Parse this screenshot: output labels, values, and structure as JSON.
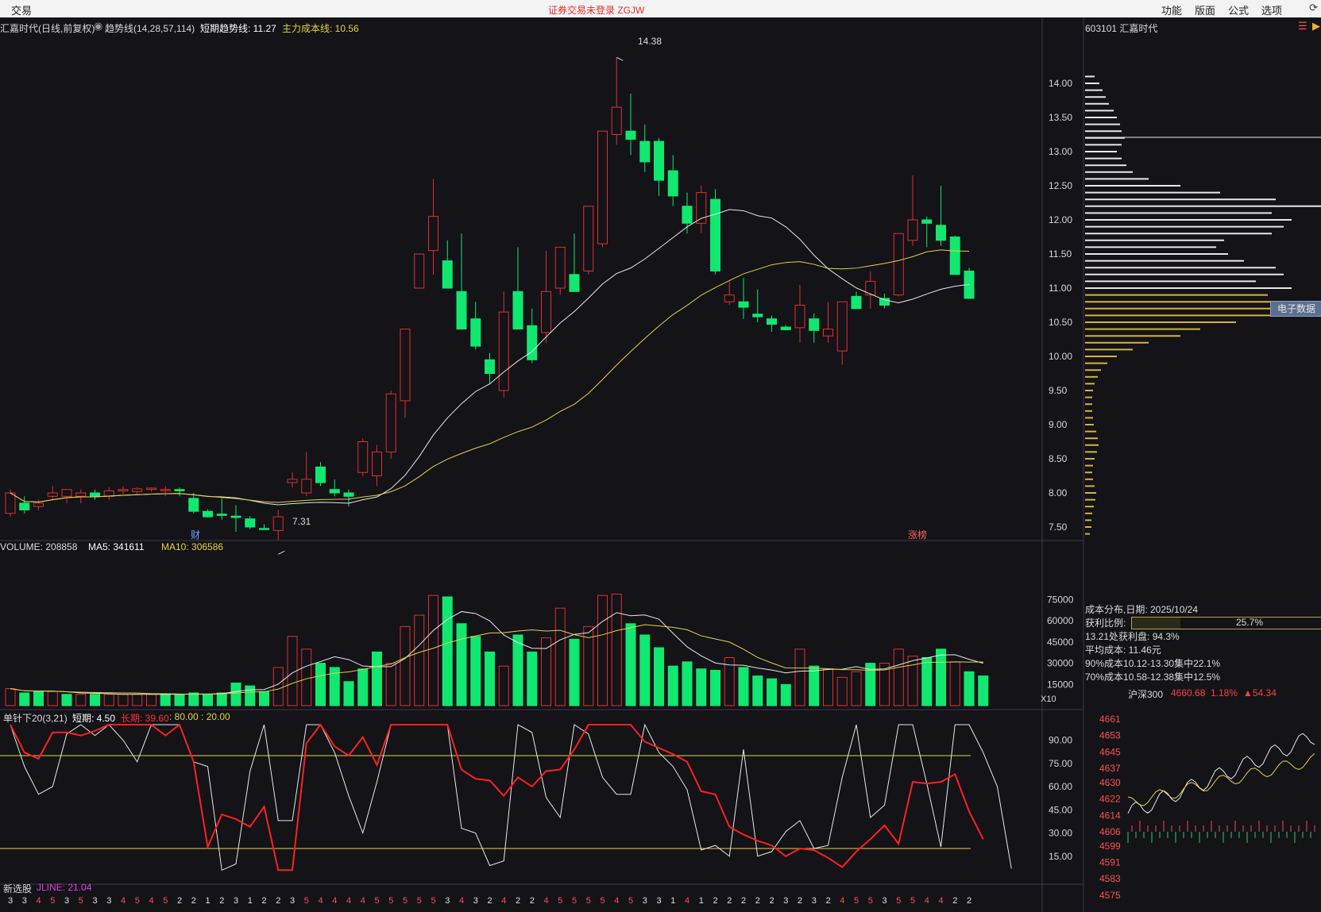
{
  "app": {
    "menu_left": "交易",
    "banner": "证券交易未登录  ZGJW",
    "menu_right": [
      "功能",
      "版面",
      "公式",
      "选项"
    ]
  },
  "main": {
    "title": "汇嘉时代(日线,前复权)",
    "ind_name": "趋势线(14,28,57,114)",
    "ind_short": "短期趋势线: 11.27",
    "ind_cost": "主力成本线: 10.56",
    "high_label": "14.38",
    "low_label": "7.31",
    "marker_cai": "财",
    "marker_zb": "涨榜",
    "y_ticks": [
      "14.00",
      "13.50",
      "13.00",
      "12.50",
      "12.00",
      "11.50",
      "11.00",
      "10.50",
      "10.00",
      "9.50",
      "9.00",
      "8.50",
      "8.00",
      "7.50"
    ]
  },
  "volume": {
    "label": "VOLUME: 208858",
    "ma5": "MA5: 341611",
    "ma10": "MA10: 306586",
    "y_ticks": [
      "75000",
      "60000",
      "45000",
      "30000",
      "15000"
    ],
    "unit": "X10"
  },
  "oscillator": {
    "name": "单针下20(3,21)",
    "short": "短期: 4.50",
    "long": "长期: 39.60",
    "levels": ": 80.00 : 20.00",
    "y_ticks": [
      "90.00",
      "75.00",
      "60.00",
      "45.00",
      "30.00",
      "15.00"
    ]
  },
  "bottom": {
    "label": "新选股",
    "jline": "JLINE: 21.04",
    "digits": [
      "3",
      "3",
      "4",
      "5",
      "3",
      "5",
      "3",
      "3",
      "4",
      "5",
      "4",
      "5",
      "2",
      "2",
      "1",
      "2",
      "3",
      "1",
      "2",
      "2",
      "3",
      "5",
      "4",
      "4",
      "4",
      "4",
      "5",
      "5",
      "5",
      "5",
      "5",
      "3",
      "4",
      "3",
      "2",
      "4",
      "2",
      "2",
      "4",
      "5",
      "5",
      "5",
      "5",
      "4",
      "5",
      "3",
      "3",
      "1",
      "4",
      "1",
      "2",
      "2",
      "2",
      "2",
      "2",
      "3",
      "2",
      "3",
      "2",
      "4",
      "5",
      "5",
      "3",
      "5",
      "5",
      "4",
      "4",
      "2",
      "2"
    ]
  },
  "right_panel": {
    "code": "603101 汇嘉时代",
    "tag": "电子数据",
    "dist_date": "成本分布,日期: 2025/10/24",
    "profit_label": "获利比例:",
    "profit_pct": "25.7%",
    "profit_value": 0.257,
    "profit_line": "13.21处获利盘: 94.3%",
    "avg_cost": "平均成本: 11.46元",
    "c90": "90%成本10.12-13.30集中22.1%",
    "c70": "70%成本10.58-12.38集中12.5%"
  },
  "index_chart": {
    "name": "沪深300",
    "price": "4660.68",
    "pct": "1.18%",
    "chg": "▲54.34",
    "y_ticks": [
      "4661",
      "4653",
      "4645",
      "4637",
      "4630",
      "4622",
      "4614",
      "4606",
      "4599",
      "4591",
      "4583",
      "4575"
    ]
  },
  "candles": [
    {
      "o": 7.7,
      "h": 8.05,
      "l": 7.65,
      "c": 8.0
    },
    {
      "o": 7.85,
      "h": 7.95,
      "l": 7.7,
      "c": 7.75
    },
    {
      "o": 7.8,
      "h": 7.9,
      "l": 7.75,
      "c": 7.85
    },
    {
      "o": 7.95,
      "h": 8.1,
      "l": 7.9,
      "c": 8.0
    },
    {
      "o": 7.95,
      "h": 8.05,
      "l": 7.85,
      "c": 8.05
    },
    {
      "o": 7.95,
      "h": 8.05,
      "l": 7.85,
      "c": 8.0
    },
    {
      "o": 8.0,
      "h": 8.05,
      "l": 7.9,
      "c": 7.95
    },
    {
      "o": 7.95,
      "h": 8.08,
      "l": 7.9,
      "c": 8.03
    },
    {
      "o": 8.03,
      "h": 8.1,
      "l": 7.98,
      "c": 8.05
    },
    {
      "o": 8.02,
      "h": 8.09,
      "l": 7.99,
      "c": 8.06
    },
    {
      "o": 8.05,
      "h": 8.08,
      "l": 8.02,
      "c": 8.07
    },
    {
      "o": 8.05,
      "h": 8.1,
      "l": 7.95,
      "c": 8.05
    },
    {
      "o": 8.05,
      "h": 8.08,
      "l": 7.95,
      "c": 8.03
    },
    {
      "o": 7.92,
      "h": 8.0,
      "l": 7.7,
      "c": 7.73
    },
    {
      "o": 7.73,
      "h": 7.76,
      "l": 7.64,
      "c": 7.65
    },
    {
      "o": 7.69,
      "h": 7.92,
      "l": 7.61,
      "c": 7.67
    },
    {
      "o": 7.66,
      "h": 7.82,
      "l": 7.43,
      "c": 7.64
    },
    {
      "o": 7.62,
      "h": 7.66,
      "l": 7.47,
      "c": 7.5
    },
    {
      "o": 7.48,
      "h": 7.54,
      "l": 7.46,
      "c": 7.47
    },
    {
      "o": 7.45,
      "h": 7.75,
      "l": 7.31,
      "c": 7.65
    },
    {
      "o": 8.15,
      "h": 8.3,
      "l": 8.08,
      "c": 8.2
    },
    {
      "o": 8.0,
      "h": 8.6,
      "l": 7.95,
      "c": 8.2
    },
    {
      "o": 8.38,
      "h": 8.45,
      "l": 8.1,
      "c": 8.15
    },
    {
      "o": 8.05,
      "h": 8.2,
      "l": 7.95,
      "c": 8.0
    },
    {
      "o": 8.0,
      "h": 8.05,
      "l": 7.8,
      "c": 7.95
    },
    {
      "o": 8.3,
      "h": 8.8,
      "l": 8.25,
      "c": 8.75
    },
    {
      "o": 8.25,
      "h": 8.7,
      "l": 8.1,
      "c": 8.6
    },
    {
      "o": 8.6,
      "h": 9.5,
      "l": 8.5,
      "c": 9.45
    },
    {
      "o": 9.35,
      "h": 10.4,
      "l": 9.1,
      "c": 10.4
    },
    {
      "o": 11.0,
      "h": 11.5,
      "l": 11.0,
      "c": 11.5
    },
    {
      "o": 11.55,
      "h": 12.6,
      "l": 11.2,
      "c": 12.05
    },
    {
      "o": 11.4,
      "h": 11.7,
      "l": 11.0,
      "c": 11.0
    },
    {
      "o": 10.95,
      "h": 11.8,
      "l": 10.5,
      "c": 10.4
    },
    {
      "o": 10.55,
      "h": 10.8,
      "l": 10.1,
      "c": 10.15
    },
    {
      "o": 9.95,
      "h": 10.05,
      "l": 9.6,
      "c": 9.75
    },
    {
      "o": 9.5,
      "h": 10.95,
      "l": 9.4,
      "c": 10.65
    },
    {
      "o": 10.95,
      "h": 11.6,
      "l": 10.5,
      "c": 10.4
    },
    {
      "o": 10.45,
      "h": 10.7,
      "l": 9.9,
      "c": 9.95
    },
    {
      "o": 10.35,
      "h": 11.55,
      "l": 10.2,
      "c": 10.95
    },
    {
      "o": 11.0,
      "h": 11.6,
      "l": 10.9,
      "c": 11.6
    },
    {
      "o": 11.2,
      "h": 11.8,
      "l": 10.95,
      "c": 10.95
    },
    {
      "o": 11.25,
      "h": 12.2,
      "l": 11.2,
      "c": 12.2
    },
    {
      "o": 11.65,
      "h": 13.3,
      "l": 11.6,
      "c": 13.3
    },
    {
      "o": 13.25,
      "h": 14.38,
      "l": 13.1,
      "c": 13.65
    },
    {
      "o": 13.3,
      "h": 13.85,
      "l": 12.95,
      "c": 13.18
    },
    {
      "o": 13.15,
      "h": 13.4,
      "l": 12.7,
      "c": 12.85
    },
    {
      "o": 13.15,
      "h": 13.2,
      "l": 12.35,
      "c": 12.58
    },
    {
      "o": 12.72,
      "h": 12.95,
      "l": 12.2,
      "c": 12.35
    },
    {
      "o": 12.2,
      "h": 12.4,
      "l": 11.8,
      "c": 11.95
    },
    {
      "o": 11.95,
      "h": 12.5,
      "l": 11.8,
      "c": 12.4
    },
    {
      "o": 12.3,
      "h": 12.45,
      "l": 11.2,
      "c": 11.25
    },
    {
      "o": 10.8,
      "h": 11.1,
      "l": 10.75,
      "c": 10.9
    },
    {
      "o": 10.8,
      "h": 11.15,
      "l": 10.55,
      "c": 10.72
    },
    {
      "o": 10.62,
      "h": 10.98,
      "l": 10.5,
      "c": 10.58
    },
    {
      "o": 10.55,
      "h": 10.6,
      "l": 10.36,
      "c": 10.47
    },
    {
      "o": 10.43,
      "h": 10.46,
      "l": 10.38,
      "c": 10.39
    },
    {
      "o": 10.42,
      "h": 11.05,
      "l": 10.2,
      "c": 10.75
    },
    {
      "o": 10.55,
      "h": 10.63,
      "l": 10.2,
      "c": 10.38
    },
    {
      "o": 10.3,
      "h": 10.8,
      "l": 10.2,
      "c": 10.4
    },
    {
      "o": 10.08,
      "h": 10.8,
      "l": 9.88,
      "c": 10.8
    },
    {
      "o": 10.88,
      "h": 10.95,
      "l": 10.7,
      "c": 10.7
    },
    {
      "o": 10.9,
      "h": 11.25,
      "l": 10.7,
      "c": 11.1
    },
    {
      "o": 10.85,
      "h": 10.92,
      "l": 10.7,
      "c": 10.75
    },
    {
      "o": 10.9,
      "h": 11.8,
      "l": 10.88,
      "c": 11.8
    },
    {
      "o": 11.7,
      "h": 12.65,
      "l": 11.62,
      "c": 12.0
    },
    {
      "o": 12.0,
      "h": 12.05,
      "l": 11.6,
      "c": 11.95
    },
    {
      "o": 11.92,
      "h": 12.5,
      "l": 11.62,
      "c": 11.7
    },
    {
      "o": 11.75,
      "h": 11.77,
      "l": 11.2,
      "c": 11.2
    },
    {
      "o": 11.25,
      "h": 11.3,
      "l": 10.85,
      "c": 10.85
    }
  ],
  "volumes": [
    12,
    9,
    10,
    10,
    8,
    8,
    8,
    8,
    8,
    8,
    8,
    8,
    8,
    9,
    8,
    9,
    16,
    14,
    10,
    27,
    49,
    40,
    30,
    27,
    17,
    26,
    38,
    30,
    56,
    64,
    78,
    77,
    58,
    49,
    38,
    28,
    50,
    38,
    48,
    69,
    47,
    56,
    78,
    79,
    58,
    50,
    41,
    28,
    31,
    26,
    25,
    34,
    27,
    21,
    19,
    15,
    40,
    28,
    26,
    20,
    24,
    30,
    30,
    40,
    35,
    34,
    40,
    31,
    24,
    21
  ],
  "vol_up": [
    1,
    0,
    0,
    1,
    0,
    1,
    0,
    1,
    1,
    1,
    1,
    0,
    0,
    0,
    0,
    0,
    0,
    0,
    0,
    1,
    1,
    1,
    0,
    0,
    0,
    0,
    0,
    1,
    1,
    1,
    1,
    0,
    0,
    0,
    0,
    1,
    0,
    0,
    1,
    1,
    0,
    1,
    1,
    1,
    0,
    0,
    0,
    0,
    0,
    0,
    0,
    1,
    0,
    0,
    0,
    0,
    1,
    0,
    1,
    1,
    1,
    0,
    1,
    1,
    1,
    0,
    0,
    1,
    0,
    0
  ],
  "osc_white": [
    100,
    73,
    55,
    60,
    94,
    100,
    93,
    100,
    90,
    76,
    100,
    100,
    100,
    76,
    73,
    6,
    10,
    70,
    100,
    38,
    38,
    100,
    100,
    82,
    54,
    30,
    63,
    100,
    100,
    100,
    100,
    100,
    33,
    30,
    9,
    12,
    100,
    95,
    53,
    40,
    100,
    94,
    66,
    55,
    55,
    100,
    82,
    73,
    58,
    19,
    22,
    15,
    84,
    15,
    18,
    31,
    38,
    20,
    22,
    66,
    100,
    40,
    48,
    100,
    100,
    62,
    21,
    100,
    100,
    82,
    60,
    7
  ],
  "osc_red": [
    100,
    82,
    78,
    95,
    95,
    93,
    96,
    100,
    100,
    100,
    100,
    93,
    100,
    76,
    21,
    42,
    39,
    34,
    47,
    6,
    6,
    88,
    100,
    86,
    80,
    92,
    74,
    100,
    100,
    100,
    100,
    100,
    71,
    65,
    64,
    54,
    66,
    60,
    70,
    71,
    84,
    100,
    100,
    100,
    100,
    89,
    85,
    81,
    76,
    57,
    55,
    34,
    29,
    25,
    22,
    15,
    20,
    19,
    14,
    8,
    18,
    26,
    35,
    23,
    63,
    62,
    63,
    68,
    44,
    26
  ],
  "chip_dist": {
    "prices": [
      14.1,
      14.0,
      13.9,
      13.8,
      13.7,
      13.6,
      13.5,
      13.4,
      13.3,
      13.2,
      13.1,
      13.0,
      12.9,
      12.8,
      12.7,
      12.6,
      12.5,
      12.4,
      12.3,
      12.2,
      12.1,
      12.0,
      11.9,
      11.8,
      11.7,
      11.6,
      11.5,
      11.4,
      11.3,
      11.2,
      11.1,
      11.0,
      10.9,
      10.8,
      10.7,
      10.6,
      10.5,
      10.4,
      10.3,
      10.2,
      10.1,
      10.0,
      9.9,
      9.8,
      9.7,
      9.6,
      9.5,
      9.4,
      9.3,
      9.2,
      9.1,
      9.0,
      8.9,
      8.8,
      8.7,
      8.6,
      8.5,
      8.4,
      8.3,
      8.2,
      8.1,
      8.0,
      7.9,
      7.8,
      7.7,
      7.6,
      7.5,
      7.4
    ],
    "weights": [
      12,
      18,
      22,
      26,
      30,
      36,
      40,
      44,
      46,
      50,
      46,
      40,
      46,
      52,
      60,
      80,
      120,
      170,
      240,
      300,
      235,
      260,
      250,
      235,
      175,
      165,
      180,
      200,
      240,
      250,
      215,
      260,
      230,
      285,
      275,
      235,
      190,
      145,
      120,
      80,
      60,
      40,
      28,
      20,
      16,
      12,
      10,
      9,
      9,
      9,
      10,
      11,
      14,
      16,
      17,
      15,
      12,
      10,
      9,
      10,
      12,
      14,
      13,
      11,
      9,
      8,
      8,
      6
    ]
  }
}
